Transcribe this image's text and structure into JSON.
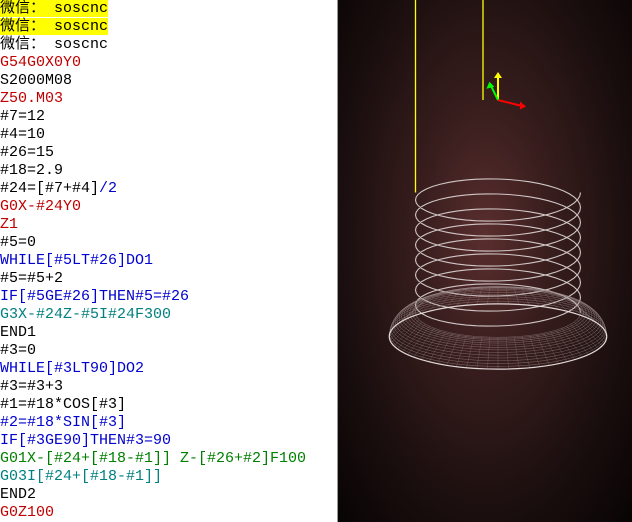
{
  "watermark": {
    "lines": [
      {
        "label": "微信：",
        "value": "soscnc"
      },
      {
        "label": "微信：",
        "value": "soscnc"
      },
      {
        "label": "微信：",
        "value": "soscnc"
      }
    ]
  },
  "code": [
    {
      "segments": [
        {
          "text": "G54G0X0Y0",
          "cls": "c-red"
        }
      ]
    },
    {
      "segments": [
        {
          "text": "S2000M08",
          "cls": "c-black"
        }
      ]
    },
    {
      "segments": [
        {
          "text": "Z50.M03",
          "cls": "c-red"
        }
      ]
    },
    {
      "segments": [
        {
          "text": "#7=12",
          "cls": "c-black"
        }
      ]
    },
    {
      "segments": [
        {
          "text": "#4=10",
          "cls": "c-black"
        }
      ]
    },
    {
      "segments": [
        {
          "text": "#26=15",
          "cls": "c-black"
        }
      ]
    },
    {
      "segments": [
        {
          "text": "#18=2.9",
          "cls": "c-black"
        }
      ]
    },
    {
      "segments": [
        {
          "text": "#24=[#7+#4]",
          "cls": "c-black"
        },
        {
          "text": "/2",
          "cls": "c-blue"
        }
      ]
    },
    {
      "segments": [
        {
          "text": "G0X-#24Y0",
          "cls": "c-red"
        }
      ]
    },
    {
      "segments": [
        {
          "text": "Z1",
          "cls": "c-red"
        }
      ]
    },
    {
      "segments": [
        {
          "text": "#5=0",
          "cls": "c-black"
        }
      ]
    },
    {
      "segments": [
        {
          "text": "WHILE[#5LT#26]DO1",
          "cls": "c-blue"
        }
      ]
    },
    {
      "segments": [
        {
          "text": "#5=#5+2",
          "cls": "c-black"
        }
      ]
    },
    {
      "segments": [
        {
          "text": "IF[#5GE#26]THEN#5=#26",
          "cls": "c-blue"
        }
      ]
    },
    {
      "segments": [
        {
          "text": "G3X-#24Z-#5I#24F300",
          "cls": "c-teal"
        }
      ]
    },
    {
      "segments": [
        {
          "text": "END1",
          "cls": "c-black"
        }
      ]
    },
    {
      "segments": [
        {
          "text": "#3=0",
          "cls": "c-black"
        }
      ]
    },
    {
      "segments": [
        {
          "text": "WHILE[#3LT90]DO2",
          "cls": "c-blue"
        }
      ]
    },
    {
      "segments": [
        {
          "text": "#3=#3+3",
          "cls": "c-black"
        }
      ]
    },
    {
      "segments": [
        {
          "text": "#1=#18*COS[#3]",
          "cls": "c-black"
        }
      ]
    },
    {
      "segments": [
        {
          "text": "#2=#18*SIN[#3]",
          "cls": "c-blue"
        }
      ]
    },
    {
      "segments": [
        {
          "text": "IF[#3GE90]THEN#3=90",
          "cls": "c-blue"
        }
      ]
    },
    {
      "segments": [
        {
          "text": "G01X-[#24+[#18-#1]] Z-[#26+#2]F100",
          "cls": "c-green"
        }
      ]
    },
    {
      "segments": [
        {
          "text": "G03I[#24+[#18-#1]]",
          "cls": "c-teal"
        }
      ]
    },
    {
      "segments": [
        {
          "text": "END2",
          "cls": "c-black"
        }
      ]
    },
    {
      "segments": [
        {
          "text": "G0Z100",
          "cls": "c-red"
        }
      ]
    }
  ],
  "viewport": {
    "origin_axes": {
      "x_color": "#ff0000",
      "y_color": "#00ff00",
      "z_color": "#ffff00"
    },
    "rapid_color": "#ffff00",
    "toolpath_color": "#e0d8d8",
    "wire_color": "#a09090"
  }
}
